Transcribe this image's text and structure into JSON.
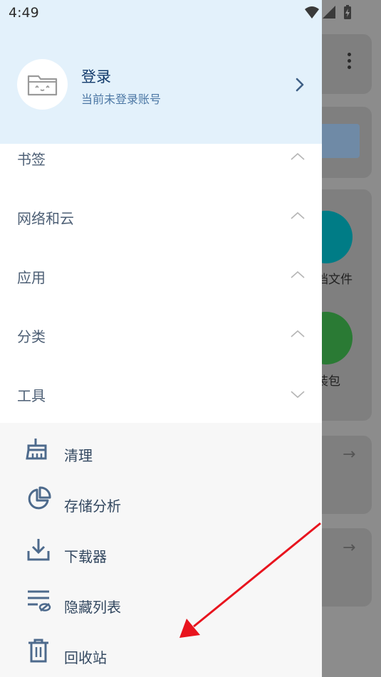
{
  "status_bar": {
    "time": "4:49"
  },
  "header": {
    "title": "登录",
    "subtitle": "当前未登录账号"
  },
  "sections": [
    {
      "label": "书签",
      "expanded": true
    },
    {
      "label": "网络和云",
      "expanded": true
    },
    {
      "label": "应用",
      "expanded": true
    },
    {
      "label": "分类",
      "expanded": true
    },
    {
      "label": "工具",
      "expanded": false
    }
  ],
  "tools": [
    {
      "label": "清理",
      "icon": "broom-icon"
    },
    {
      "label": "存储分析",
      "icon": "pie-chart-icon"
    },
    {
      "label": "下载器",
      "icon": "download-icon"
    },
    {
      "label": "隐藏列表",
      "icon": "hidden-list-icon"
    },
    {
      "label": "回收站",
      "icon": "trash-icon"
    }
  ],
  "background": {
    "labels": [
      "档文件",
      "装包"
    ]
  },
  "colors": {
    "header_bg": "#e3f1fb",
    "title": "#123a6b",
    "accent_blue": "#4d78a5",
    "annotation": "#e8141e"
  }
}
